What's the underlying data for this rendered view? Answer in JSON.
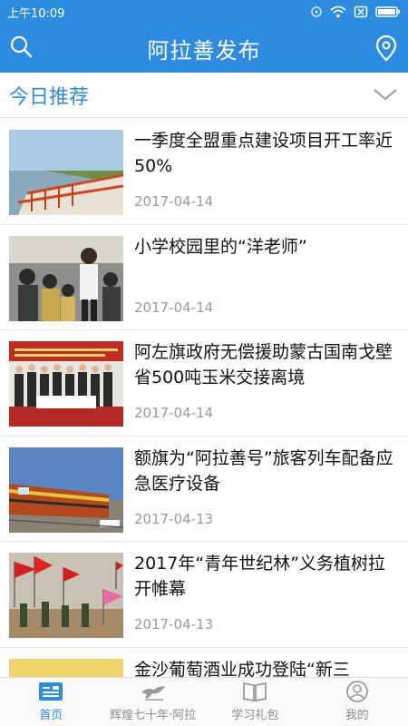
{
  "status_bar": {
    "time": "上午10:09"
  },
  "header": {
    "title": "阿拉善发布"
  },
  "section": {
    "title": "今日推荐"
  },
  "news": [
    {
      "title": "一季度全盟重点建设项目开工率近50%",
      "date": "2017-04-14",
      "thumb": "lake-pier-photo"
    },
    {
      "title": "小学校园里的“洋老师”",
      "date": "2017-04-14",
      "thumb": "classroom-photo"
    },
    {
      "title": "阿左旗政府无偿援助蒙古国南戈壁省500吨玉米交接离境",
      "date": "2017-04-14",
      "thumb": "ceremony-photo"
    },
    {
      "title": "额旗为“阿拉善号”旅客列车配备应急医疗设备",
      "date": "2017-04-13",
      "thumb": "train-photo"
    },
    {
      "title": "2017年“青年世纪林”义务植树拉开帷幕",
      "date": "2017-04-13",
      "thumb": "tree-planting-photo"
    },
    {
      "title": "金沙葡萄酒业成功登陆“新三",
      "date": "",
      "thumb": "winery-photo"
    }
  ],
  "tabs": [
    {
      "label": "首页",
      "icon": "news-icon",
      "active": true
    },
    {
      "label": "辉煌七十年·阿拉",
      "icon": "horse-icon",
      "active": false
    },
    {
      "label": "学习礼包",
      "icon": "book-icon",
      "active": false
    },
    {
      "label": "我的",
      "icon": "user-icon",
      "active": false
    }
  ],
  "colors": {
    "brand": "#2d8ce0",
    "text": "#111111",
    "date": "#9a9a9a",
    "tab_inactive": "#8c8c8c"
  }
}
